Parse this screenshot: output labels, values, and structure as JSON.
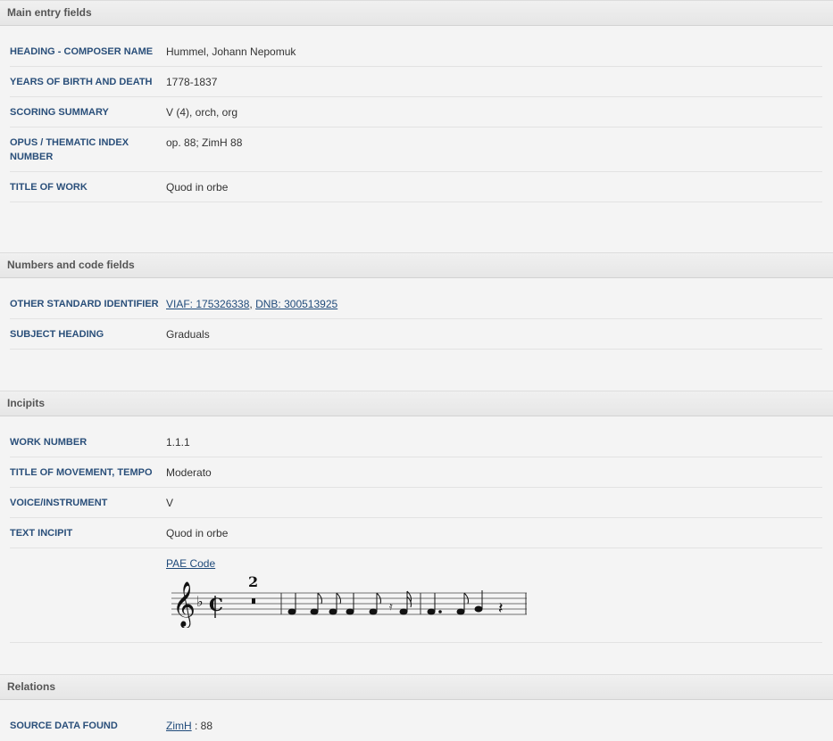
{
  "main": {
    "header": "Main entry fields",
    "rows": [
      {
        "label": "HEADING - COMPOSER NAME",
        "value": "Hummel, Johann Nepomuk"
      },
      {
        "label": "YEARS OF BIRTH AND DEATH",
        "value": "1778-1837"
      },
      {
        "label": "SCORING SUMMARY",
        "value": "V (4), orch, org"
      },
      {
        "label": "OPUS / THEMATIC INDEX NUMBER",
        "value": "op. 88; ZimH 88"
      },
      {
        "label": "TITLE OF WORK",
        "value": "Quod in orbe"
      }
    ]
  },
  "numbers": {
    "header": "Numbers and code fields",
    "identifier_label": "OTHER STANDARD IDENTIFIER",
    "viaf": "VIAF: 175326338",
    "dnb": "DNB: 300513925",
    "identifier_sep": ",",
    "subject_label": "SUBJECT HEADING",
    "subject_value": "Graduals"
  },
  "incipits": {
    "header": "Incipits",
    "rows": [
      {
        "label": "WORK NUMBER",
        "value": "1.1.1"
      },
      {
        "label": "TITLE OF MOVEMENT, TEMPO",
        "value": "Moderato"
      },
      {
        "label": "VOICE/INSTRUMENT",
        "value": "V"
      },
      {
        "label": "TEXT INCIPIT",
        "value": "Quod in orbe"
      }
    ],
    "pae_link": "PAE Code",
    "rest_count": "2"
  },
  "relations": {
    "header": "Relations",
    "source_label": "SOURCE DATA FOUND",
    "source_link": "ZimH",
    "source_rest": ": 88"
  }
}
